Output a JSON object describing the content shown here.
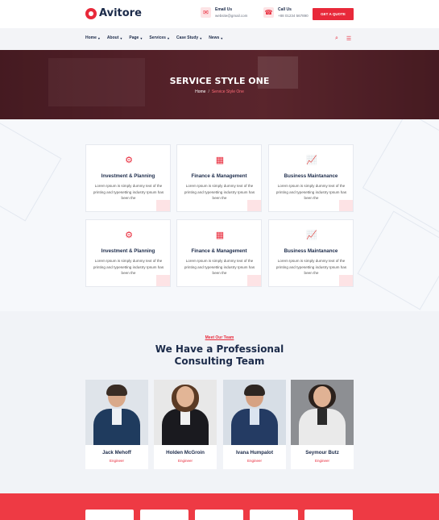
{
  "header": {
    "logo_text": "Avitore",
    "email_label": "Email Us",
    "email_value": "website@gmail.com",
    "call_label": "Call Us",
    "call_value": "+88 01234 567890",
    "quote_button": "GET A QUOTE"
  },
  "nav": {
    "items": [
      "Home",
      "About",
      "Page",
      "Services",
      "Case Study",
      "News"
    ]
  },
  "hero": {
    "title": "SERVICE STYLE ONE",
    "crumb_home": "Home",
    "crumb_sep": "/",
    "crumb_current": "Service Style One"
  },
  "services": {
    "cards": [
      {
        "title": "Investment & Planning",
        "desc": "Lorem Ipsum is simply dummy text of the printing and typesetting industry Ipsum has been the",
        "icon": "investment-icon"
      },
      {
        "title": "Finance & Management",
        "desc": "Lorem Ipsum is simply dummy text of the printing and typesetting industry Ipsum has been the",
        "icon": "finance-icon"
      },
      {
        "title": "Business Maintanance",
        "desc": "Lorem Ipsum is simply dummy text of the printing and typesetting industry Ipsum has been the",
        "icon": "chart-icon"
      },
      {
        "title": "Investment & Planning",
        "desc": "Lorem Ipsum is simply dummy text of the printing and typesetting industry Ipsum has been the",
        "icon": "investment-icon"
      },
      {
        "title": "Finance & Management",
        "desc": "Lorem Ipsum is simply dummy text of the printing and typesetting industry Ipsum has been the",
        "icon": "finance-icon"
      },
      {
        "title": "Business Maintanance",
        "desc": "Lorem Ipsum is simply dummy text of the printing and typesetting industry Ipsum has been the",
        "icon": "chart-icon"
      }
    ]
  },
  "team": {
    "subtitle": "Meet Our Team",
    "title_line1": "We Have a Professional",
    "title_line2": "Consulting Team",
    "members": [
      {
        "name": "Jack Mehoff",
        "role": "Engineer"
      },
      {
        "name": "Holden McGroin",
        "role": "Engineer"
      },
      {
        "name": "Ivana Humpalot",
        "role": "Engineer"
      },
      {
        "name": "Seymour Butz",
        "role": "Engineer"
      }
    ]
  },
  "colors": {
    "accent": "#e8293a",
    "navy": "#1c2b4a",
    "footer": "#ee3a44"
  }
}
